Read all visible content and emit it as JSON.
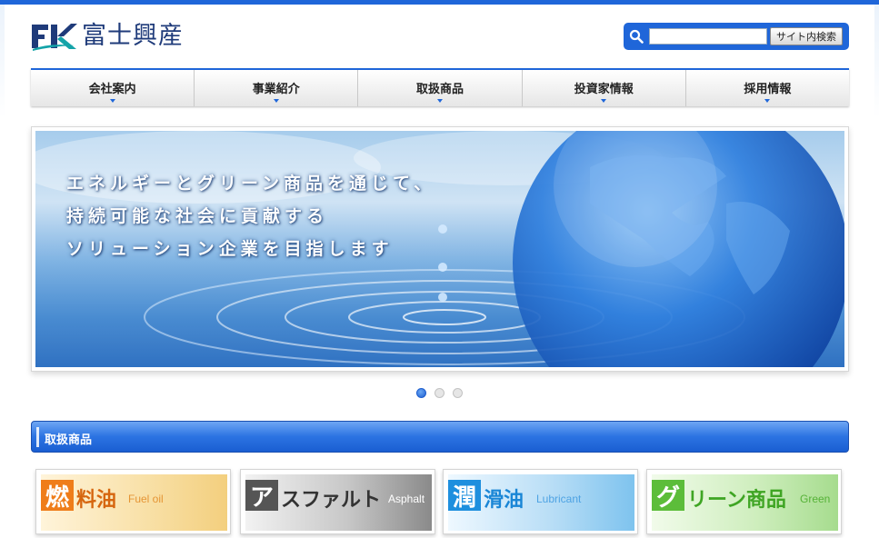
{
  "brand": {
    "logo_letters": "FK",
    "company_name": "富士興産",
    "colors": {
      "primary": "#1f66d9",
      "navy": "#1f3b7a",
      "teal": "#14a3a8"
    }
  },
  "search": {
    "input_value": "",
    "placeholder": "",
    "button_label": "サイト内検索",
    "icon": "search-icon"
  },
  "nav": {
    "items": [
      {
        "label": "会社案内"
      },
      {
        "label": "事業紹介"
      },
      {
        "label": "取扱商品"
      },
      {
        "label": "投資家情報"
      },
      {
        "label": "採用情報"
      }
    ]
  },
  "hero": {
    "lines": [
      "エネルギーとグリーン商品を通じて、",
      "持続可能な社会に貢献する",
      "ソリューション企業を目指します"
    ],
    "slides": {
      "count": 3,
      "active_index": 1
    }
  },
  "section": {
    "title": "取扱商品"
  },
  "products": [
    {
      "box_char": "燃",
      "name": "料油",
      "english": "Fuel oil",
      "box_color": "#ef7d1a",
      "text_color": "#d6660f",
      "bg": "#f8dfa4"
    },
    {
      "box_char": "ア",
      "name": "スファルト",
      "english": "Asphalt",
      "box_color": "#555555",
      "text_color": "#333333",
      "bg": "#bdbdbd"
    },
    {
      "box_char": "潤",
      "name": "滑油",
      "english": "Lubricant",
      "box_color": "#1e8fde",
      "text_color": "#1a86d6",
      "bg": "#b9def6"
    },
    {
      "box_char": "グ",
      "name": "リーン商品",
      "english": "Green",
      "box_color": "#5cbd3a",
      "text_color": "#3fa524",
      "bg": "#cfeebe"
    }
  ]
}
